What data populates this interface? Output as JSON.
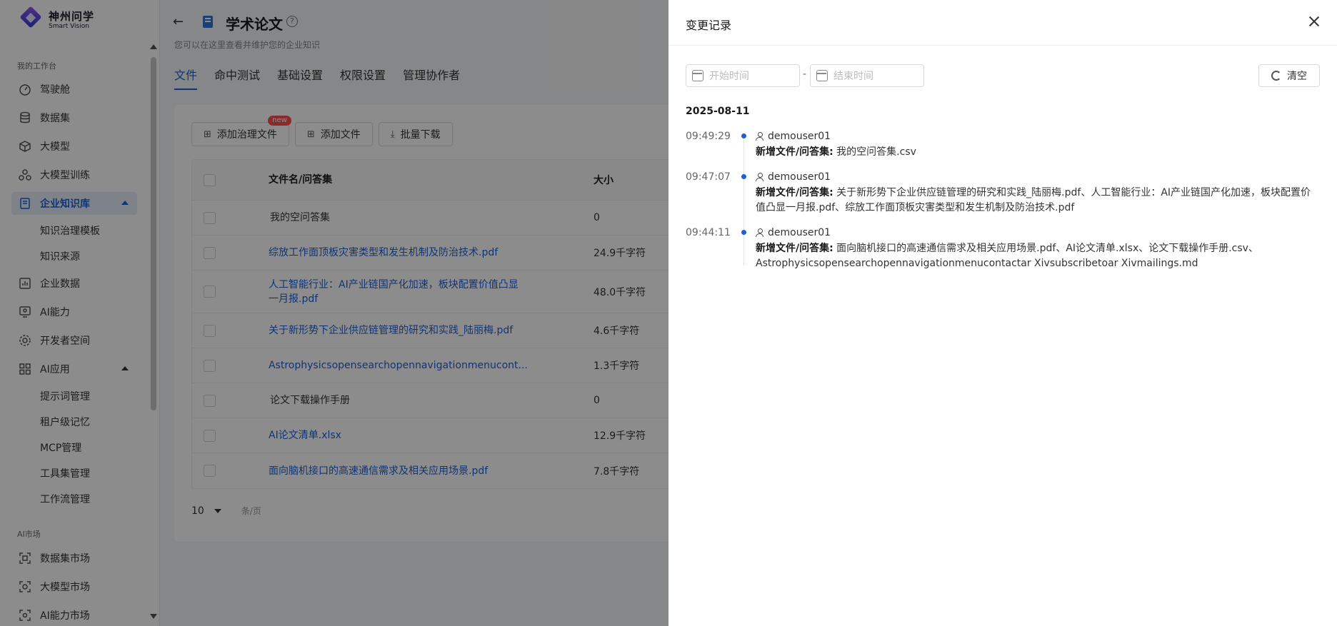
{
  "sidebar": {
    "logo_cn": "神州问学",
    "logo_en": "Smart Vision",
    "section_workspace": "我的工作台",
    "items": [
      {
        "label": "驾驶舱"
      },
      {
        "label": "数据集"
      },
      {
        "label": "大模型"
      },
      {
        "label": "大模型训练"
      },
      {
        "label": "企业知识库"
      },
      {
        "label": "企业数据"
      },
      {
        "label": "AI能力"
      },
      {
        "label": "开发者空间"
      },
      {
        "label": "AI应用"
      }
    ],
    "kb_subitems": [
      "知识治理模板",
      "知识来源"
    ],
    "ai_app_subitems": [
      "提示词管理",
      "租户级记忆",
      "MCP管理",
      "工具集管理",
      "工作流管理"
    ],
    "section_market": "AI市场",
    "market_items": [
      {
        "label": "数据集市场"
      },
      {
        "label": "大模型市场"
      },
      {
        "label": "AI能力市场"
      }
    ]
  },
  "header": {
    "title": "学术论文",
    "subtitle": "您可以在这里查看并维护您的企业知识",
    "tabs": [
      "文件",
      "命中测试",
      "基础设置",
      "权限设置",
      "管理协作者"
    ]
  },
  "toolbar": {
    "add_governed": "添加治理文件",
    "new_badge": "new",
    "add_file": "添加文件",
    "batch_download": "批量下载"
  },
  "table": {
    "columns": [
      "文件名/问答集",
      "大小"
    ],
    "rows": [
      {
        "name": "我的空问答集",
        "size": "0"
      },
      {
        "name": "综放工作面顶板灾害类型和发生机制及防治技术.pdf",
        "size": "24.9千字符"
      },
      {
        "name": "人工智能行业：AI产业链国产化加速，板块配置价值凸显一月报.pdf",
        "size": "48.0千字符"
      },
      {
        "name": "关于新形势下企业供应链管理的研究和实践_陆丽梅.pdf",
        "size": "4.6千字符"
      },
      {
        "name": "Astrophysicsopensearchopennavigationmenucont...",
        "size": "1.3千字符"
      },
      {
        "name": "论文下载操作手册",
        "size": "0"
      },
      {
        "name": "AI论文清单.xlsx",
        "size": "12.9千字符"
      },
      {
        "name": "面向脑机接口的高速通信需求及相关应用场景.pdf",
        "size": "7.8千字符"
      }
    ]
  },
  "pagination": {
    "page_size": "10",
    "unit": "条/页"
  },
  "drawer": {
    "title": "变更记录",
    "start_placeholder": "开始时间",
    "end_placeholder": "结束时间",
    "separator": "-",
    "clear_label": "清空",
    "date": "2025-08-11",
    "entries": [
      {
        "time": "09:49:29",
        "user": "demouser01",
        "action": "新增文件/问答集:",
        "detail": "我的空问答集.csv"
      },
      {
        "time": "09:47:07",
        "user": "demouser01",
        "action": "新增文件/问答集:",
        "detail": "关于新形势下企业供应链管理的研究和实践_陆丽梅.pdf、人工智能行业：AI产业链国产化加速，板块配置价值凸显一月报.pdf、综放工作面顶板灾害类型和发生机制及防治技术.pdf"
      },
      {
        "time": "09:44:11",
        "user": "demouser01",
        "action": "新增文件/问答集:",
        "detail": "面向脑机接口的高速通信需求及相关应用场景.pdf、AI论文清单.xlsx、论文下载操作手册.csv、Astrophysicsopensearchopennavigationmenucontactar Xivsubscribetoar Xivmailings.md"
      }
    ]
  },
  "colors": {
    "accent": "#1f5fd6",
    "badge": "#ff4d4f",
    "overlay": "rgba(0,0,0,0.45)"
  }
}
